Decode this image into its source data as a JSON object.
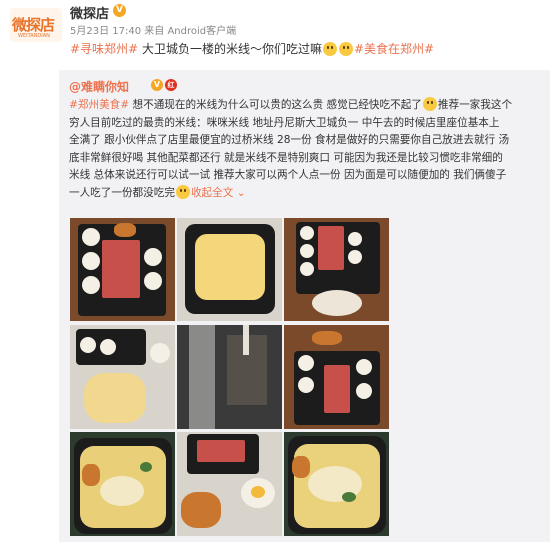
{
  "post": {
    "avatar_text": "微探店",
    "avatar_sub": "WEITANDIAN",
    "author": "微探店",
    "verified_mark": "V",
    "meta": "5月23日 17:40 来自 Android客户端",
    "headline_tag1": "#寻味郑州#",
    "headline_text": " 大卫城负一楼的米线～你们吃过嘛",
    "headline_tag2": "#美食在郑州#"
  },
  "repost": {
    "user": "@难瞒你知",
    "verified_mark": "V",
    "red_badge": "红",
    "tag": "#郑州美食#",
    "line1": " 想不通现在的米线为什么可以贵的这么贵 感觉已经快吃不起了",
    "line1b": "推荐一家我这个",
    "line2": "穷人目前吃过的最贵的米线：咪咪米线  地址丹尼斯大卫城负一  中午去的时候店里座位基本上",
    "line3": "全满了 跟小伙伴点了店里最便宜的过桥米线  28一份  食材是做好的只需要你自己放进去就行 汤",
    "line4": "底非常鲜很好喝 其他配菜都还行 就是米线不是特别爽口 可能因为我还是比较习惯吃非常细的",
    "line5": "米线 总体来说还行可以试一试 推荐大家可以两个人点一份 因为面是可以随便加的 我们俩傻子",
    "line6": "一人吃了一份都没吃完",
    "collapse": "收起全文",
    "collapse_arrow": "⌄"
  },
  "images": [
    {
      "name": "photo-1"
    },
    {
      "name": "photo-2"
    },
    {
      "name": "photo-3"
    },
    {
      "name": "photo-4"
    },
    {
      "name": "photo-5"
    },
    {
      "name": "photo-6"
    },
    {
      "name": "photo-7"
    },
    {
      "name": "photo-8"
    },
    {
      "name": "photo-9"
    }
  ],
  "colors": {
    "accent": "#eb7350",
    "verified": "#f5a623",
    "repost_bg": "#f2f2f5"
  }
}
